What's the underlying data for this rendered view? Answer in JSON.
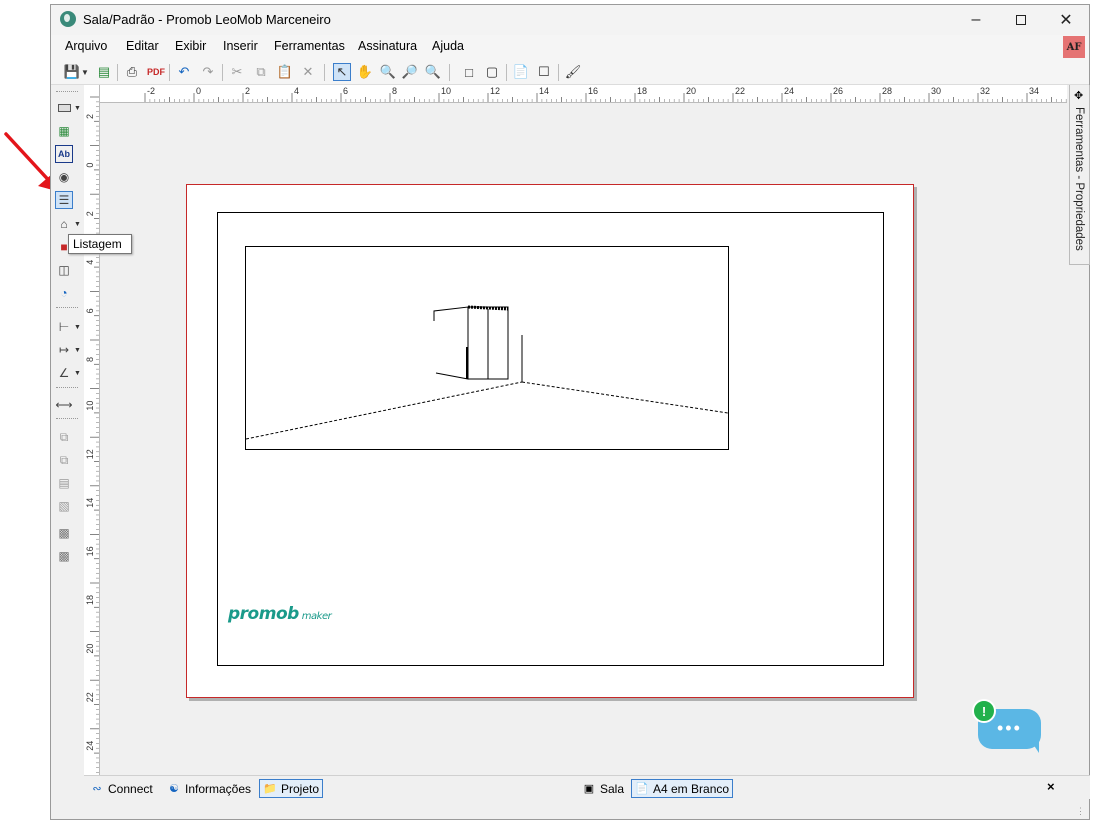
{
  "window": {
    "title": "Sala/Padrão - Promob LeoMob Marceneiro",
    "minimize_icon": "minimize-icon",
    "maximize_icon": "maximize-icon",
    "close_icon": "close-icon"
  },
  "menu": {
    "items": [
      "Arquivo",
      "Editar",
      "Exibir",
      "Inserir",
      "Ferramentas",
      "Assinatura",
      "Ajuda"
    ],
    "user_badge": "AF"
  },
  "toolbar": {
    "icons": [
      "save-icon",
      "dropdown-icon",
      "export-icon",
      "print-icon",
      "pdf-icon",
      "undo-icon",
      "redo-icon",
      "cut-icon",
      "copy-icon",
      "paste-icon",
      "delete-icon",
      "select-icon",
      "pan-icon",
      "zoom-window-icon",
      "zoom-out-icon",
      "zoom-icon",
      "frame-icon",
      "frame-alt-icon",
      "import-icon",
      "page-icon",
      "paint-icon"
    ]
  },
  "left_tools": {
    "icons": [
      "rectangle-icon",
      "image-icon",
      "text-icon",
      "eye-icon",
      "listagem-icon",
      "view-icon",
      "object-icon",
      "table-icon",
      "chart-icon",
      "dimension-icon",
      "dimension-alt-icon",
      "angle-icon",
      "measure-icon",
      "group-icon",
      "ungroup-icon",
      "align-icon",
      "distribute-icon",
      "resize-icon",
      "transform-icon"
    ],
    "tooltip": "Listagem"
  },
  "ruler": {
    "top_labels": [
      "-2",
      "0",
      "2",
      "4",
      "6",
      "8",
      "10",
      "12",
      "14",
      "16",
      "18",
      "20",
      "22",
      "24",
      "26",
      "28",
      "30",
      "32",
      "34"
    ],
    "left_labels": [
      "2",
      "0",
      "2",
      "4",
      "6",
      "8",
      "10",
      "12",
      "14",
      "16",
      "18",
      "20",
      "22",
      "24"
    ]
  },
  "page": {
    "logo_main": "promob",
    "logo_sub": "maker"
  },
  "side_panel": {
    "label": "Ferramentas - Propriedades",
    "icon": "tools-icon"
  },
  "bottom_bar": {
    "tabs_left": [
      {
        "label": "Connect",
        "icon": "rss-icon"
      },
      {
        "label": "Informações",
        "icon": "globe-icon"
      },
      {
        "label": "Projeto",
        "icon": "folder-icon"
      }
    ],
    "tabs_right": [
      {
        "label": "Sala",
        "icon": "room-icon"
      },
      {
        "label": "A4 em Branco",
        "icon": "page-layout-icon"
      }
    ],
    "close_label": "×"
  },
  "chat": {
    "badge": "!",
    "dots": "•••"
  }
}
